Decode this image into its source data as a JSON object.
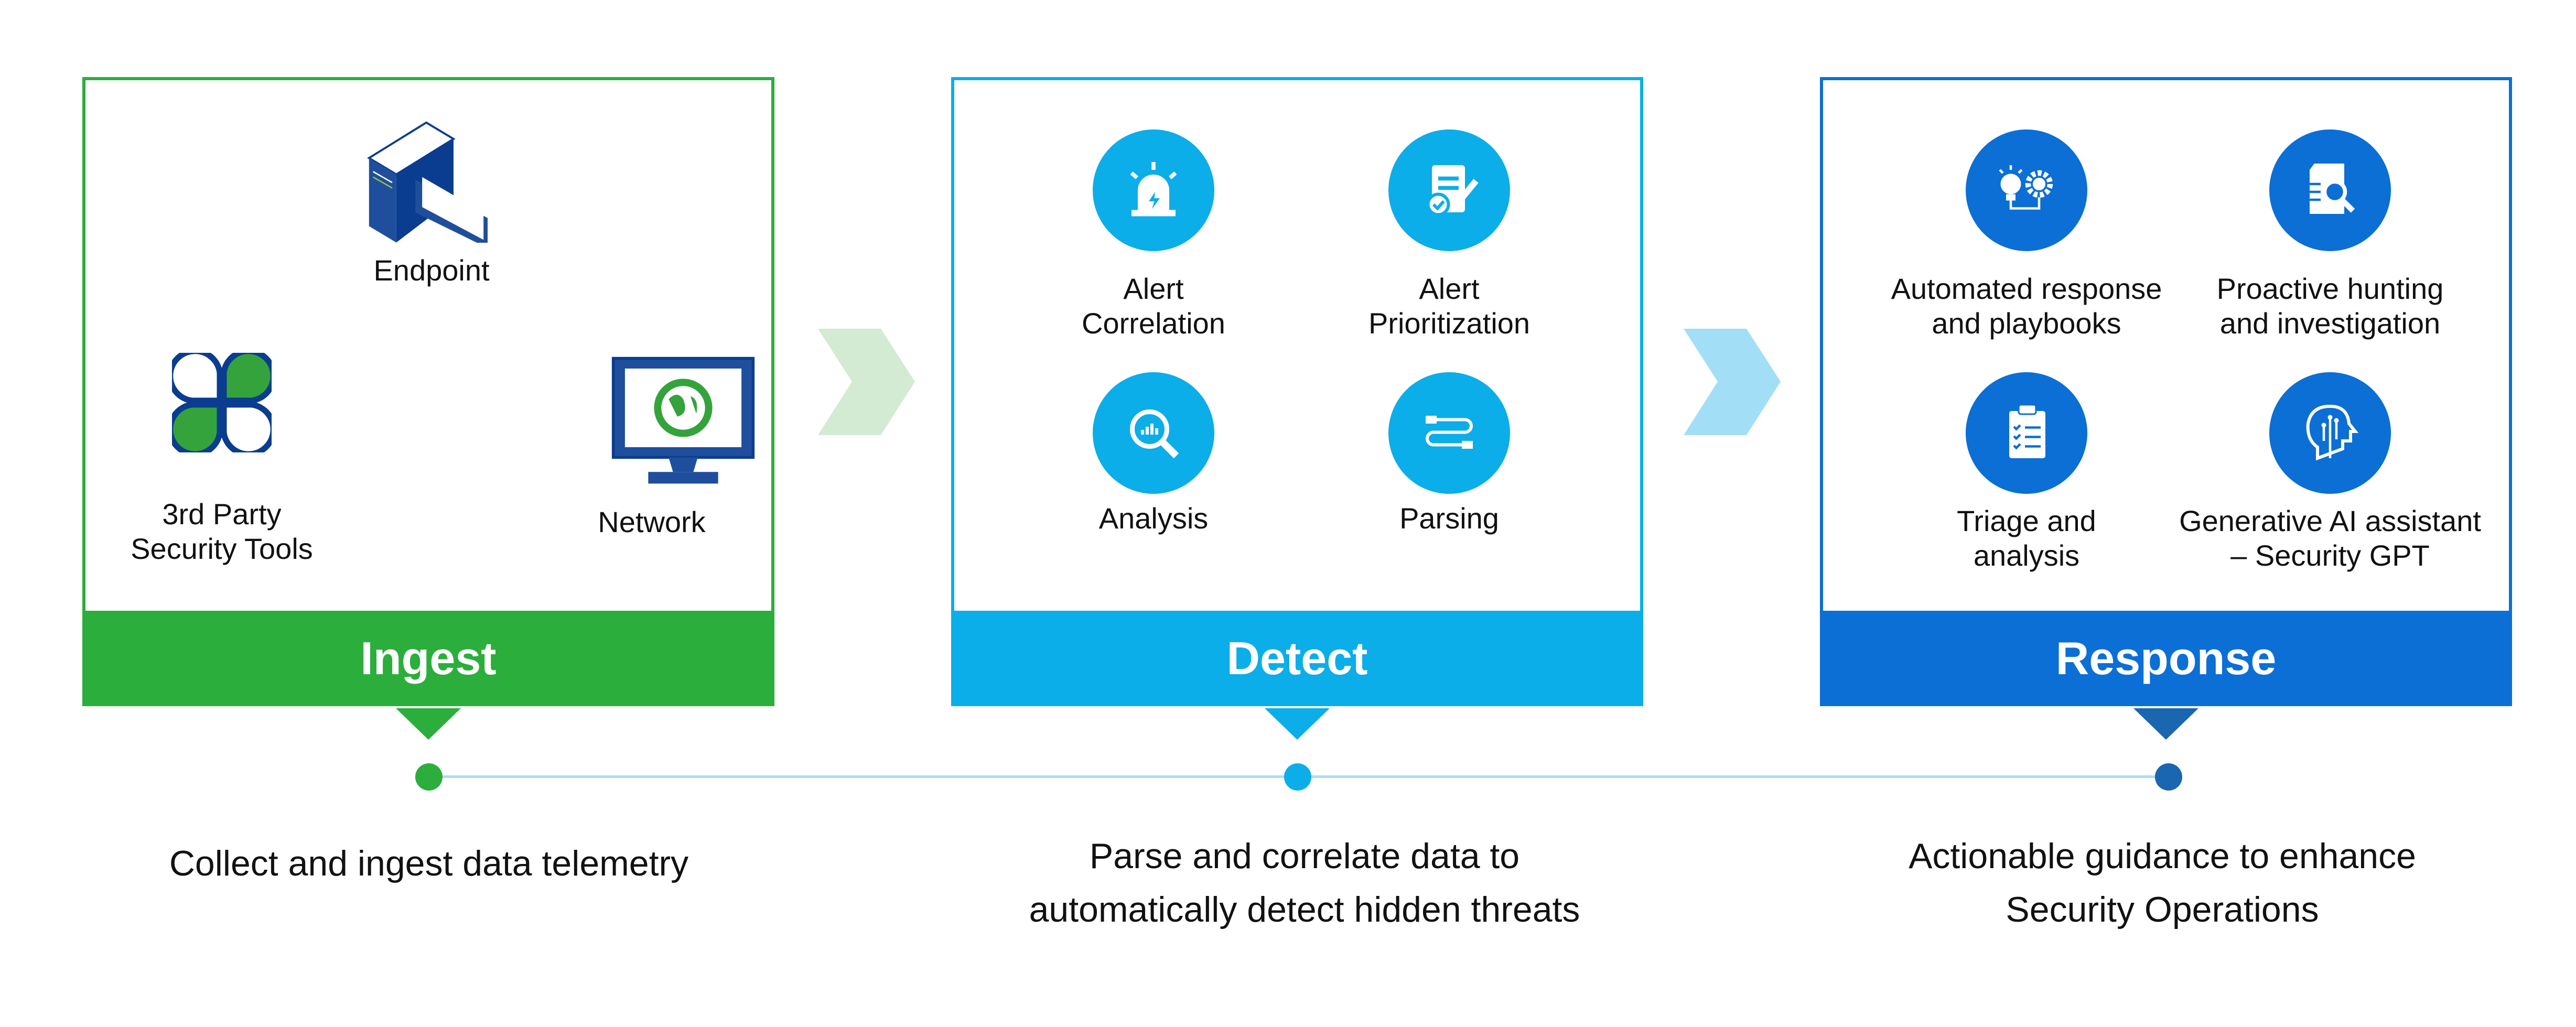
{
  "colors": {
    "ingest": "#2bae3b",
    "detect": "#0baee8",
    "response": "#0b6fd6",
    "response_notch": "#1a66b0",
    "ingest_chevron": "#d3ead3",
    "detect_chevron": "#a2dff6",
    "timeline": "#a9ddf5",
    "device_blue": "#0a3d8f"
  },
  "stages": [
    {
      "title": "Ingest",
      "description": "Collect and ingest data telemetry",
      "items": [
        {
          "label": "Endpoint",
          "icon": "desktop-computer-icon"
        },
        {
          "label": "3rd Party\nSecurity Tools",
          "icon": "clover-tools-icon"
        },
        {
          "label": "Network",
          "icon": "globe-monitor-icon"
        }
      ]
    },
    {
      "title": "Detect",
      "description": "Parse and correlate data to\nautomatically detect hidden threats",
      "items": [
        {
          "label": "Alert\nCorrelation",
          "icon": "alarm-light-icon"
        },
        {
          "label": "Alert\nPrioritization",
          "icon": "document-check-icon"
        },
        {
          "label": "Analysis",
          "icon": "magnifier-chart-icon"
        },
        {
          "label": "Parsing",
          "icon": "flow-parse-icon"
        }
      ]
    },
    {
      "title": "Response",
      "description": "Actionable guidance  to enhance\nSecurity Operations",
      "items": [
        {
          "label": "Automated response\nand playbooks",
          "icon": "bulb-gear-icon"
        },
        {
          "label": "Proactive hunting\nand investigation",
          "icon": "document-search-icon"
        },
        {
          "label": "Triage and\nanalysis",
          "icon": "clipboard-checklist-icon"
        },
        {
          "label": "Generative AI assistant\n– Security GPT",
          "icon": "ai-head-icon"
        }
      ]
    }
  ]
}
